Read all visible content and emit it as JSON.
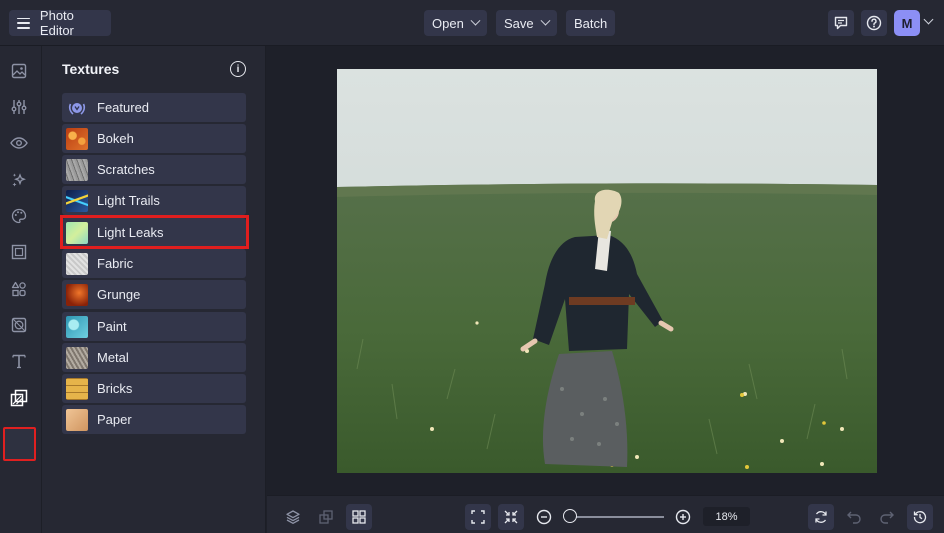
{
  "topbar": {
    "app_title": "Photo Editor",
    "menu_open": "Open",
    "menu_save": "Save",
    "menu_batch": "Batch",
    "avatar_initial": "M",
    "icons": [
      "menu-icon",
      "comment-icon",
      "help-icon",
      "chevron-down-icon"
    ]
  },
  "sidebar": {
    "tools": [
      "image-icon",
      "adjust-sliders-icon",
      "eye-icon",
      "sparkle-effects-icon",
      "palette-icon",
      "frame-icon",
      "graphics-shapes-icon",
      "overlay-icon",
      "text-icon",
      "textures-icon"
    ],
    "active_tool": "textures-icon"
  },
  "panel": {
    "title": "Textures",
    "items": [
      {
        "label": "Featured",
        "swatch": "#3b4060"
      },
      {
        "label": "Bokeh",
        "swatch": "#d8621d"
      },
      {
        "label": "Scratches",
        "swatch": "#8f8f8f"
      },
      {
        "label": "Light Trails",
        "swatch": "#1c3d76"
      },
      {
        "label": "Light Leaks",
        "swatch": "#a9e4a4"
      },
      {
        "label": "Fabric",
        "swatch": "#d7d7d7"
      },
      {
        "label": "Grunge",
        "swatch": "#c0421a"
      },
      {
        "label": "Paint",
        "swatch": "#4fb8cc"
      },
      {
        "label": "Metal",
        "swatch": "#9a9288"
      },
      {
        "label": "Bricks",
        "swatch": "#d8a63a"
      },
      {
        "label": "Paper",
        "swatch": "#e0b081"
      }
    ],
    "selected": "Light Leaks"
  },
  "bottombar": {
    "zoom_label": "18%",
    "zoom_value": 0.18,
    "icons": [
      "layers-icon",
      "transform-icon",
      "grid-icon",
      "fit-screen-icon",
      "shrink-icon",
      "zoom-out-icon",
      "zoom-in-icon",
      "refresh-icon",
      "undo-icon",
      "redo-icon",
      "history-icon"
    ]
  },
  "colors": {
    "accent": "#8c8ff5",
    "highlight": "#e01e1e",
    "topbar_bg": "#262833",
    "canvas_bg": "#1e2029"
  }
}
